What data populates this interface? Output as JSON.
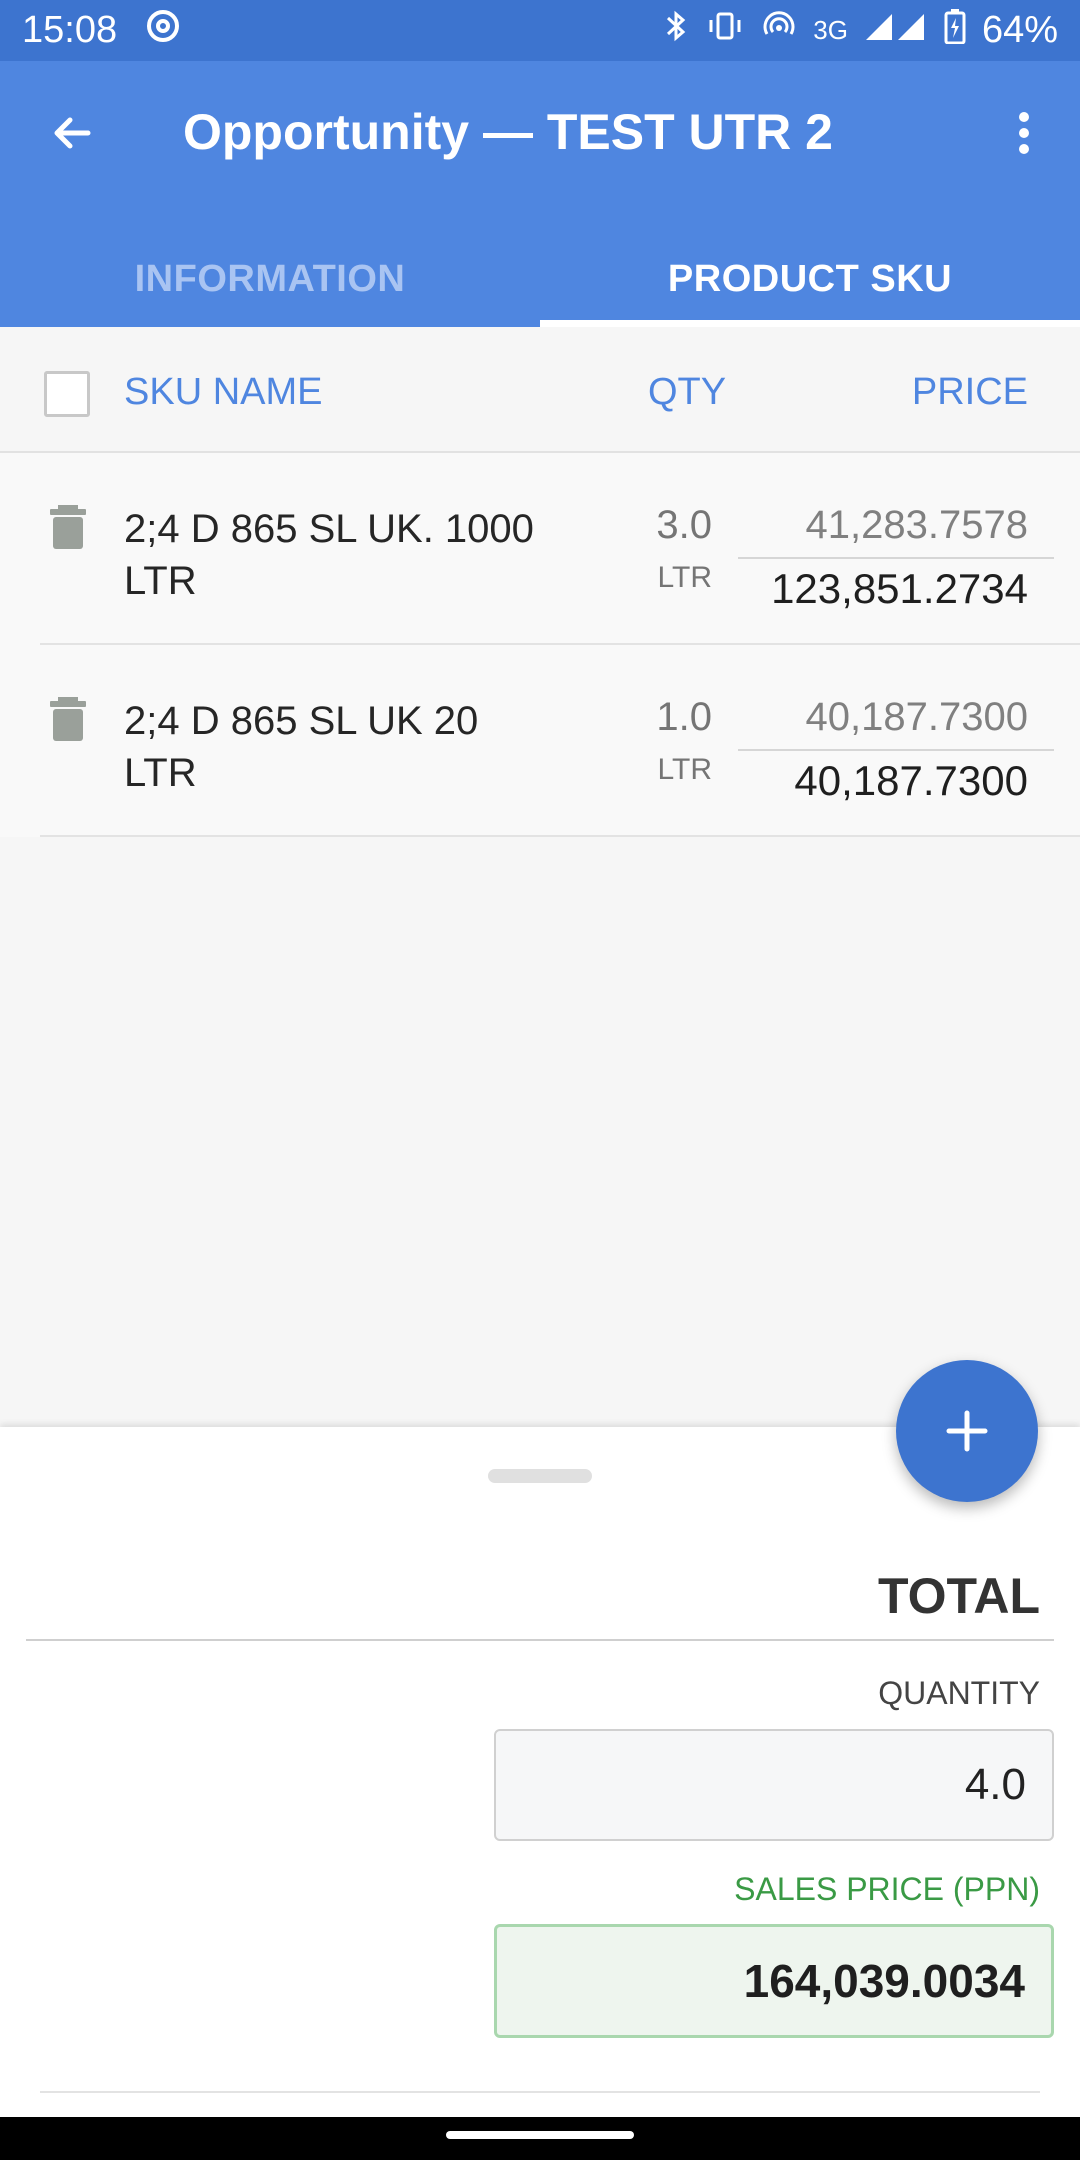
{
  "status_bar": {
    "time": "15:08",
    "network": "3G",
    "battery": "64%",
    "icons": [
      "at-sign-icon",
      "bluetooth-icon",
      "vibrate-icon",
      "hotspot-icon",
      "signal-icon",
      "battery-icon"
    ]
  },
  "app_bar": {
    "title": "Opportunity — TEST UTR 2",
    "tabs": [
      {
        "label": "INFORMATION",
        "active": false
      },
      {
        "label": "PRODUCT SKU",
        "active": true
      }
    ]
  },
  "list": {
    "columns": {
      "sku_name": "SKU NAME",
      "qty": "QTY",
      "price": "PRICE"
    },
    "items": [
      {
        "name": "2;4 D 865 SL UK. 1000 LTR",
        "qty": "3.0",
        "unit": "LTR",
        "unit_price": "41,283.7578",
        "total_price": "123,851.2734"
      },
      {
        "name": "2;4 D 865 SL UK 20 LTR",
        "qty": "1.0",
        "unit": "LTR",
        "unit_price": "40,187.7300",
        "total_price": "40,187.7300"
      }
    ]
  },
  "summary": {
    "total_label": "TOTAL",
    "quantity_label": "QUANTITY",
    "quantity_value": "4.0",
    "sales_price_label": "SALES PRICE (PPN)",
    "sales_price_value": "164,039.0034"
  },
  "colors": {
    "status_bar": "#3d74cf",
    "app_bar": "#4f86e0",
    "accent": "#4f86e0",
    "fab": "#3d74cf",
    "sales_green": "#3a9a45"
  }
}
